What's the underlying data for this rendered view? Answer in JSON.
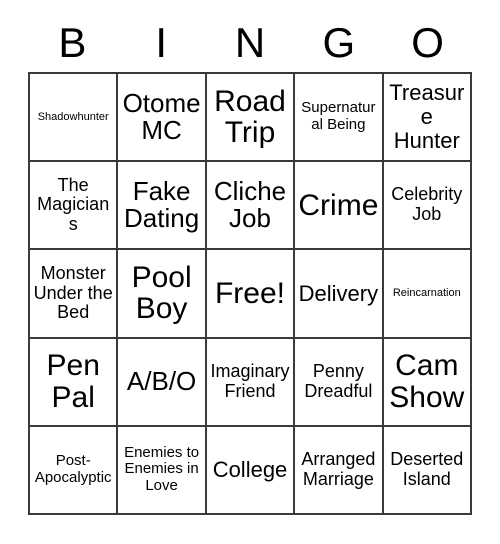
{
  "card": {
    "header_letters": [
      "B",
      "I",
      "N",
      "G",
      "O"
    ],
    "columns": 5,
    "rows": 5,
    "free_space_label": "Free!",
    "free_space_position": {
      "row": 3,
      "column": 3
    },
    "border_color": "#3a3a3a",
    "background_color": "#ffffff",
    "text_color": "#000000",
    "cells": [
      {
        "text": "Shadowhunter",
        "size": "xs"
      },
      {
        "text": "Otome MC",
        "size": "xl"
      },
      {
        "text": "Road Trip",
        "size": "xxl"
      },
      {
        "text": "Supernatural Being",
        "size": "sm"
      },
      {
        "text": "Treasure Hunter",
        "size": "lg"
      },
      {
        "text": "The Magicians",
        "size": "md"
      },
      {
        "text": "Fake Dating",
        "size": "xl"
      },
      {
        "text": "Cliche Job",
        "size": "xl"
      },
      {
        "text": "Crime",
        "size": "xxl"
      },
      {
        "text": "Celebrity Job",
        "size": "md"
      },
      {
        "text": "Monster Under the Bed",
        "size": "md"
      },
      {
        "text": "Pool Boy",
        "size": "xxl"
      },
      {
        "text": "Free!",
        "size": "xxl"
      },
      {
        "text": "Delivery",
        "size": "lg"
      },
      {
        "text": "Reincarnation",
        "size": "xs"
      },
      {
        "text": "Pen Pal",
        "size": "xxl"
      },
      {
        "text": "A/B/O",
        "size": "xl"
      },
      {
        "text": "Imaginary Friend",
        "size": "md"
      },
      {
        "text": "Penny Dreadful",
        "size": "md"
      },
      {
        "text": "Cam Show",
        "size": "xxl"
      },
      {
        "text": "Post-Apocalyptic",
        "size": "sm"
      },
      {
        "text": "Enemies to Enemies in Love",
        "size": "sm"
      },
      {
        "text": "College",
        "size": "lg"
      },
      {
        "text": "Arranged Marriage",
        "size": "md"
      },
      {
        "text": "Deserted Island",
        "size": "md"
      }
    ]
  }
}
